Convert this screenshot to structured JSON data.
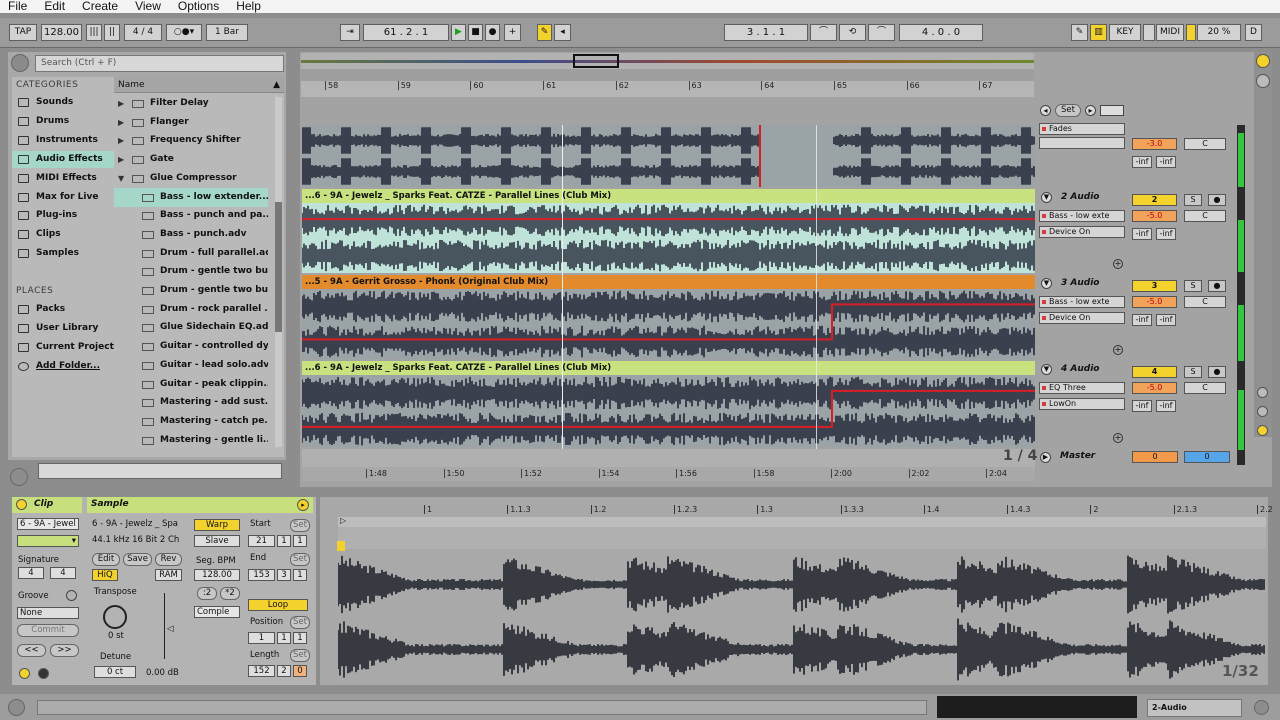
{
  "menu": {
    "file": "File",
    "edit": "Edit",
    "create": "Create",
    "view": "View",
    "options": "Options",
    "help": "Help"
  },
  "transport": {
    "tap": "TAP",
    "tempo": "128.00",
    "time_sig": "4 / 4",
    "quant": "1 Bar",
    "position": "61 . 2 . 1",
    "loop_start": "3 . 1 . 1",
    "loop_length": "4 . 0 . 0",
    "key": "KEY",
    "midi": "MIDI",
    "cpu": "20 %",
    "d": "D"
  },
  "browser": {
    "search_placeholder": "Search (Ctrl + F)",
    "categories_heading": "CATEGORIES",
    "categories": [
      "Sounds",
      "Drums",
      "Instruments",
      "Audio Effects",
      "MIDI Effects",
      "Max for Live",
      "Plug-ins",
      "Clips",
      "Samples"
    ],
    "places_heading": "PLACES",
    "places": [
      "Packs",
      "User Library",
      "Current Project",
      "Add Folder..."
    ],
    "name_col": "Name",
    "folders": [
      "Filter Delay",
      "Flanger",
      "Frequency Shifter",
      "Gate",
      "Glue Compressor"
    ],
    "presets": [
      "Bass - low extender....",
      "Bass - punch and pa...",
      "Bass - punch.adv",
      "Drum - full parallel.adv",
      "Drum - gentle two bu...",
      "Drum - gentle two bu...",
      "Drum - rock parallel ...",
      "Glue Sidechain EQ.adv",
      "Guitar - controlled dy...",
      "Guitar - lead solo.adv",
      "Guitar - peak clippin...",
      "Mastering - add sust...",
      "Mastering - catch pe...",
      "Mastering - gentle li..."
    ]
  },
  "arrangement": {
    "bars": [
      "58",
      "59",
      "60",
      "61",
      "62",
      "63",
      "64",
      "65",
      "66",
      "67"
    ],
    "times": [
      "1:48",
      "1:50",
      "1:52",
      "1:54",
      "1:56",
      "1:58",
      "2:00",
      "2:02",
      "2:04"
    ],
    "zoom_label": "1 / 4",
    "set_label": "Set",
    "tracks": [
      {
        "clip": "",
        "name": "",
        "device": "Fades",
        "chooser": "",
        "num": "",
        "vol": "-3.0",
        "pan": "C",
        "color": "#1c1f28"
      },
      {
        "clip": "...6 - 9A - Jewelz _ Sparks Feat. CATZE - Parallel Lines (Club Mix)",
        "name": "2 Audio",
        "device": "Bass - low exte",
        "chooser": "Device On",
        "num": "2",
        "vol": "-5.0",
        "pan": "C",
        "color": "#bfe3d8",
        "bar": "#c7e27e"
      },
      {
        "clip": "...5 - 9A - Gerrit Grosso - Phonk (Original Club Mix)",
        "name": "3 Audio",
        "device": "Bass - low exte",
        "chooser": "Device On",
        "num": "3",
        "vol": "-5.0",
        "pan": "C",
        "color": "#1c1f28",
        "bar": "#e28a2c"
      },
      {
        "clip": "...6 - 9A - Jewelz _ Sparks Feat. CATZE - Parallel Lines (Club Mix)",
        "name": "4 Audio",
        "device": "EQ Three",
        "chooser": "LowOn",
        "num": "4",
        "vol": "-5.0",
        "pan": "C",
        "color": "#1c1f28",
        "bar": "#c7e27e"
      }
    ],
    "master": {
      "name": "Master",
      "num": "0",
      "value": "0"
    },
    "inf": "-inf"
  },
  "clip": {
    "title": "Clip",
    "name": "6 - 9A - Jewel",
    "signature_label": "Signature",
    "sig_num": "4",
    "sig_den": "4",
    "groove_label": "Groove",
    "groove": "None",
    "commit": "Commit",
    "back": "<<",
    "fwd": ">>"
  },
  "sample": {
    "title": "Sample",
    "name": "6 - 9A - Jewelz _ Spa",
    "info": "44.1 kHz 16 Bit 2 Ch",
    "warp": "Warp",
    "slave": "Slave",
    "edit": "Edit",
    "save": "Save",
    "rev": "Rev",
    "hiq": "HiQ",
    "ram": "RAM",
    "seg_bpm_label": "Seg. BPM",
    "seg_bpm": "128.00",
    "transpose_label": "Transpose",
    "transpose": "0 st",
    "detune_label": "Detune",
    "detune": "0 ct",
    "gain": "0.00 dB",
    "div2": ":2",
    "mul2": "*2",
    "mode": "Comple",
    "start_label": "Start",
    "start": [
      "21",
      "1",
      "1"
    ],
    "end_label": "End",
    "end": [
      "153",
      "3",
      "1"
    ],
    "loop": "Loop",
    "position_label": "Position",
    "position": [
      "1",
      "1",
      "1"
    ],
    "length_label": "Length",
    "length": [
      "152",
      "2",
      "0"
    ],
    "set": "Set"
  },
  "sample_ruler": [
    "1",
    "1.1.3",
    "1.2",
    "1.2.3",
    "1.3",
    "1.3.3",
    "1.4",
    "1.4.3",
    "2",
    "2.1.3",
    "2.2"
  ],
  "sample_zoom": "1/32",
  "status": {
    "track": "2-Audio"
  }
}
